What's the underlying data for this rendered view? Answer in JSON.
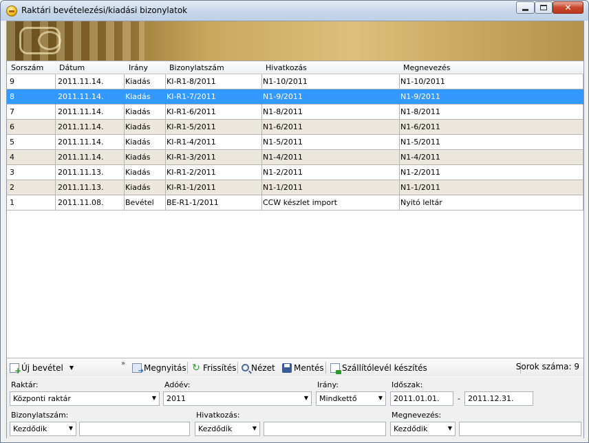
{
  "window": {
    "title": "Raktári bevételezési/kiadási bizonylatok"
  },
  "grid": {
    "columns": [
      "Sorszám",
      "Dátum",
      "Irány",
      "Bizonylatszám",
      "Hivatkozás",
      "Megnevezés"
    ],
    "rows": [
      [
        "9",
        "2011.11.14.",
        "Kiadás",
        "KI-R1-8/2011",
        "N1-10/2011",
        "N1-10/2011"
      ],
      [
        "8",
        "2011.11.14.",
        "Kiadás",
        "KI-R1-7/2011",
        "N1-9/2011",
        "N1-9/2011"
      ],
      [
        "7",
        "2011.11.14.",
        "Kiadás",
        "KI-R1-6/2011",
        "N1-8/2011",
        "N1-8/2011"
      ],
      [
        "6",
        "2011.11.14.",
        "Kiadás",
        "KI-R1-5/2011",
        "N1-6/2011",
        "N1-6/2011"
      ],
      [
        "5",
        "2011.11.14.",
        "Kiadás",
        "KI-R1-4/2011",
        "N1-5/2011",
        "N1-5/2011"
      ],
      [
        "4",
        "2011.11.14.",
        "Kiadás",
        "KI-R1-3/2011",
        "N1-4/2011",
        "N1-4/2011"
      ],
      [
        "3",
        "2011.11.13.",
        "Kiadás",
        "KI-R1-2/2011",
        "N1-2/2011",
        "N1-2/2011"
      ],
      [
        "2",
        "2011.11.13.",
        "Kiadás",
        "KI-R1-1/2011",
        "N1-1/2011",
        "N1-1/2011"
      ],
      [
        "1",
        "2011.11.08.",
        "Bevétel",
        "BE-R1-1/2011",
        "CCW készlet import",
        "Nyitó leltár"
      ]
    ],
    "selected_row": 1
  },
  "toolbar": {
    "new_label": "Új bevétel",
    "open_label": "Megnyitás",
    "refresh_label": "Frissítés",
    "view_label": "Nézet",
    "save_label": "Mentés",
    "delivery_label": "Szállítólevél készítés",
    "row_count_label": "Sorok száma:",
    "row_count_value": "9"
  },
  "filters": {
    "warehouse_label": "Raktár:",
    "warehouse_value": "Központi raktár",
    "taxyear_label": "Adóév:",
    "taxyear_value": "2011",
    "direction_label": "Irány:",
    "direction_value": "Mindkettő",
    "period_label": "Időszak:",
    "period_from": "2011.01.01.",
    "period_sep": "-",
    "period_to": "2011.12.31.",
    "docno_label": "Bizonylatszám:",
    "docno_mode": "Kezdődik",
    "docno_value": "",
    "reference_label": "Hivatkozás:",
    "reference_mode": "Kezdődik",
    "reference_value": "",
    "name_label": "Megnevezés:",
    "name_mode": "Kezdődik",
    "name_value": ""
  },
  "icons": {
    "app": "app-icon",
    "new": "new-document-icon",
    "open": "open-document-icon",
    "refresh": "refresh-icon",
    "view": "magnifier-icon",
    "save": "floppy-disk-icon",
    "delivery": "delivery-note-icon"
  },
  "colors": {
    "selected_row": "#3399ff",
    "alt_row": "#ece7dc"
  }
}
